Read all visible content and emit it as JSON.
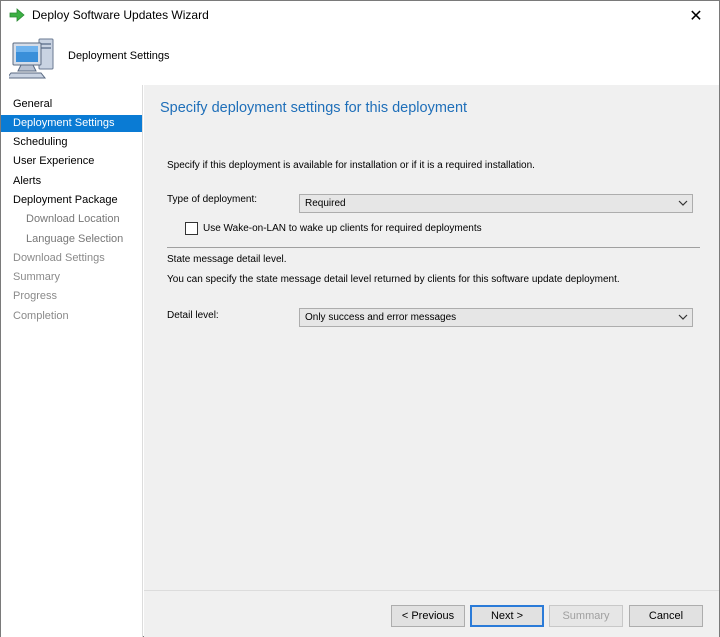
{
  "window": {
    "title": "Deploy Software Updates Wizard",
    "close_glyph": "✕"
  },
  "banner": {
    "title": "Deployment Settings"
  },
  "nav": {
    "items": [
      {
        "label": "General"
      },
      {
        "label": "Deployment Settings"
      },
      {
        "label": "Scheduling"
      },
      {
        "label": "User Experience"
      },
      {
        "label": "Alerts"
      },
      {
        "label": "Deployment Package"
      },
      {
        "label": "Download Location"
      },
      {
        "label": "Language Selection"
      },
      {
        "label": "Download Settings"
      },
      {
        "label": "Summary"
      },
      {
        "label": "Progress"
      },
      {
        "label": "Completion"
      }
    ]
  },
  "main": {
    "heading": "Specify deployment settings for this deployment",
    "intro": "Specify if this deployment is available for installation or if it is a required installation.",
    "type_label": "Type of deployment:",
    "type_value": "Required",
    "wol_label": "Use Wake-on-LAN to wake up clients for required deployments",
    "wol_checked": false,
    "state_heading": "State message detail level.",
    "state_desc": "You can specify the state message detail level returned by clients for this software update deployment.",
    "detail_label": "Detail level:",
    "detail_value": "Only success and error messages"
  },
  "footer": {
    "previous": "< Previous",
    "next": "Next >",
    "summary": "Summary",
    "cancel": "Cancel"
  },
  "colors": {
    "accent": "#0a7bd4",
    "heading": "#1f6fb9",
    "pane": "#f0f0f0"
  }
}
